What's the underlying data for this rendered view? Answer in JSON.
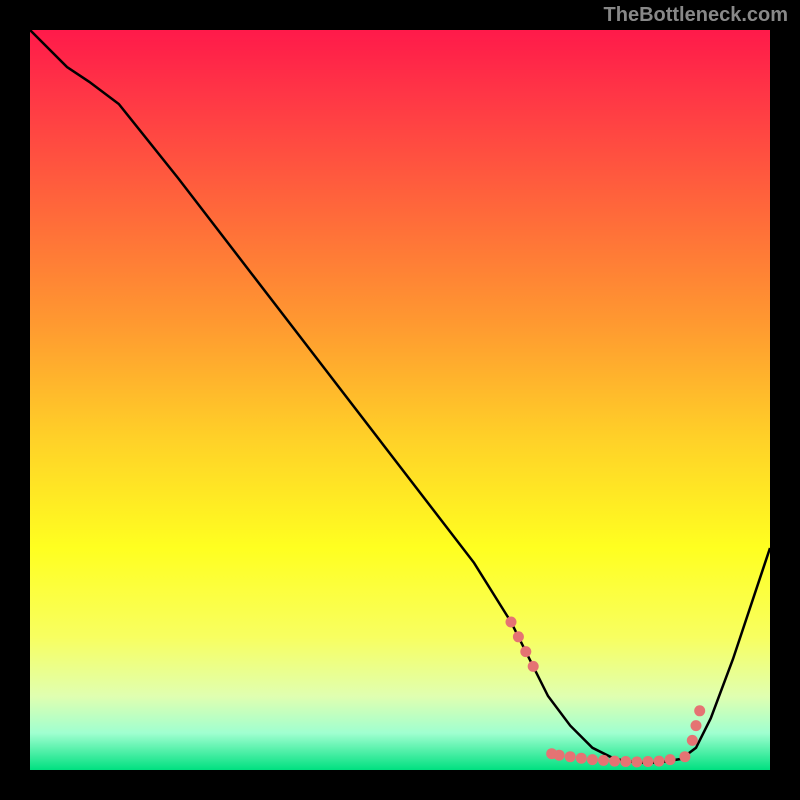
{
  "attribution": "TheBottleneck.com",
  "chart_data": {
    "type": "line",
    "title": "",
    "xlabel": "",
    "ylabel": "",
    "xlim": [
      0,
      100
    ],
    "ylim": [
      0,
      100
    ],
    "background_gradient": {
      "stops": [
        {
          "offset": 0,
          "color": "#ff1a4a"
        },
        {
          "offset": 10,
          "color": "#ff3a45"
        },
        {
          "offset": 25,
          "color": "#ff6a3a"
        },
        {
          "offset": 40,
          "color": "#ff9a30"
        },
        {
          "offset": 55,
          "color": "#ffd028"
        },
        {
          "offset": 70,
          "color": "#ffff20"
        },
        {
          "offset": 82,
          "color": "#f8ff60"
        },
        {
          "offset": 90,
          "color": "#e0ffb0"
        },
        {
          "offset": 95,
          "color": "#a0ffd0"
        },
        {
          "offset": 100,
          "color": "#00e080"
        }
      ]
    },
    "series": [
      {
        "name": "bottleneck-curve",
        "color": "#000000",
        "x": [
          0,
          5,
          8,
          12,
          20,
          30,
          40,
          50,
          60,
          65,
          68,
          70,
          73,
          76,
          79,
          82,
          85,
          88,
          90,
          92,
          95,
          100
        ],
        "y": [
          100,
          95,
          93,
          90,
          80,
          67,
          54,
          41,
          28,
          20,
          14,
          10,
          6,
          3,
          1.5,
          1,
          1,
          1.5,
          3,
          7,
          15,
          30
        ]
      }
    ],
    "markers": {
      "name": "highlight-points",
      "color": "#e57373",
      "points": [
        {
          "x": 65,
          "y": 20
        },
        {
          "x": 66,
          "y": 18
        },
        {
          "x": 67,
          "y": 16
        },
        {
          "x": 68,
          "y": 14
        },
        {
          "x": 70.5,
          "y": 2.2
        },
        {
          "x": 71.5,
          "y": 2.0
        },
        {
          "x": 73,
          "y": 1.8
        },
        {
          "x": 74.5,
          "y": 1.6
        },
        {
          "x": 76,
          "y": 1.4
        },
        {
          "x": 77.5,
          "y": 1.3
        },
        {
          "x": 79,
          "y": 1.2
        },
        {
          "x": 80.5,
          "y": 1.15
        },
        {
          "x": 82,
          "y": 1.1
        },
        {
          "x": 83.5,
          "y": 1.15
        },
        {
          "x": 85,
          "y": 1.2
        },
        {
          "x": 86.5,
          "y": 1.4
        },
        {
          "x": 88.5,
          "y": 1.8
        },
        {
          "x": 89.5,
          "y": 4
        },
        {
          "x": 90,
          "y": 6
        },
        {
          "x": 90.5,
          "y": 8
        }
      ]
    }
  }
}
